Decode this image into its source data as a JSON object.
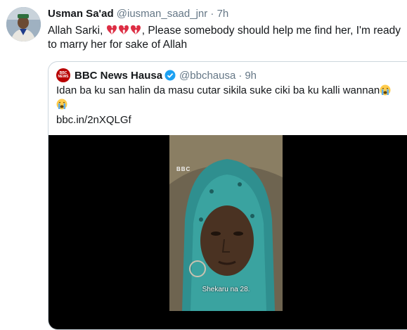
{
  "tweet": {
    "author_name": "Usman Sa'ad",
    "author_handle": "@iusman_saad_jnr",
    "separator": "·",
    "time": "7h",
    "text_prefix": "Allah Sarki, ",
    "text_suffix": ", Please somebody should help me find her, I'm ready to marry her for sake of Allah",
    "heart_icons": [
      "broken-heart-icon",
      "broken-heart-icon",
      "broken-heart-icon"
    ]
  },
  "quoted_tweet": {
    "author_name": "BBC News Hausa",
    "author_handle": "@bbchausa",
    "separator": "·",
    "time": "9h",
    "logo_text_top": "BBC",
    "logo_text_bottom": "NEWS",
    "text": "Idan ba ku san halin da masu cutar sikila suke ciki ba ku kalli wannan",
    "emoji": [
      "crying-face-icon",
      "crying-face-icon"
    ],
    "link": "bbc.in/2nXQLGf",
    "video": {
      "watermark": "BBC",
      "caption": "Shekaru na 28."
    }
  },
  "colors": {
    "text": "#14171a",
    "secondary": "#657786",
    "border": "#ccd6dd",
    "verified": "#1da1f2",
    "broken_heart": "#dd2e44",
    "bbc_red": "#b80000"
  }
}
